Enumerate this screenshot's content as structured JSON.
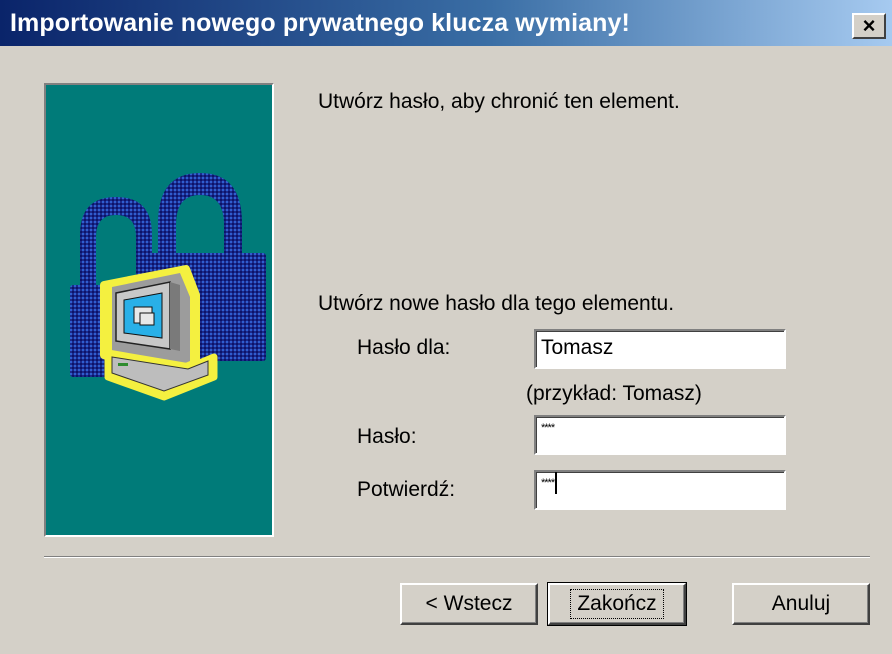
{
  "window": {
    "title": "Importowanie nowego prywatnego klucza wymiany!",
    "close_label": "×"
  },
  "content": {
    "intro_text": "Utwórz hasło, aby chronić ten element.",
    "section_text": "Utwórz nowe hasło dla tego elementu.",
    "password_for_label": "Hasło dla:",
    "password_for_value": "Tomasz",
    "example_text": "(przykład: Tomasz)",
    "password_label": "Hasło:",
    "password_value": "****",
    "confirm_label": "Potwierdź:",
    "confirm_value": "****"
  },
  "buttons": {
    "back_label": "< Wstecz",
    "finish_label": "Zakończ",
    "cancel_label": "Anuluj"
  },
  "illustration": {
    "icons": [
      "padlock-icon",
      "padlock-icon",
      "computer-icon"
    ],
    "panel_color": "#007b79"
  }
}
